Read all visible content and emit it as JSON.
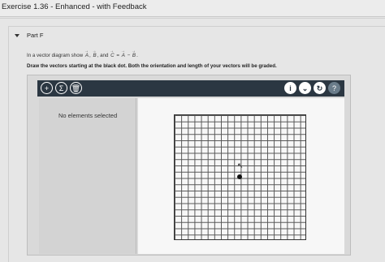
{
  "exercise": {
    "title": "Exercise 1.36 - Enhanced - with Feedback"
  },
  "part": {
    "label": "Part F",
    "prompt": {
      "before_a": "In a vector diagram show",
      "a": "A",
      "mid1": ",",
      "b": "B",
      "mid2": ", and",
      "c": "C",
      "eq": "=",
      "a2": "A",
      "minus": "−",
      "b2": "B",
      "end": "."
    },
    "instruction": "Draw the vectors starting at the black dot. Both the orientation and length of your vectors will be graded."
  },
  "toolbar": {
    "left_buttons": [
      {
        "name": "add-vector-button",
        "glyph": "+",
        "icon": "plus-icon"
      },
      {
        "name": "sum-button",
        "glyph": "Σ",
        "icon": "sigma-icon"
      },
      {
        "name": "delete-button",
        "glyph": "🗑",
        "icon": "trash-icon"
      }
    ],
    "right_buttons": [
      {
        "name": "info-button",
        "glyph": "i",
        "icon": "info-icon"
      },
      {
        "name": "expand-button",
        "glyph": "⌄",
        "icon": "chevron-down-icon"
      },
      {
        "name": "reset-button",
        "glyph": "↻",
        "icon": "reset-icon"
      },
      {
        "name": "help-button",
        "glyph": "?",
        "icon": "help-icon"
      }
    ]
  },
  "panel": {
    "no_selection_text": "No elements selected"
  },
  "colors": {
    "toolbar": "#2b3742",
    "canvas": "#f7f7f7",
    "dot": "#111111"
  }
}
